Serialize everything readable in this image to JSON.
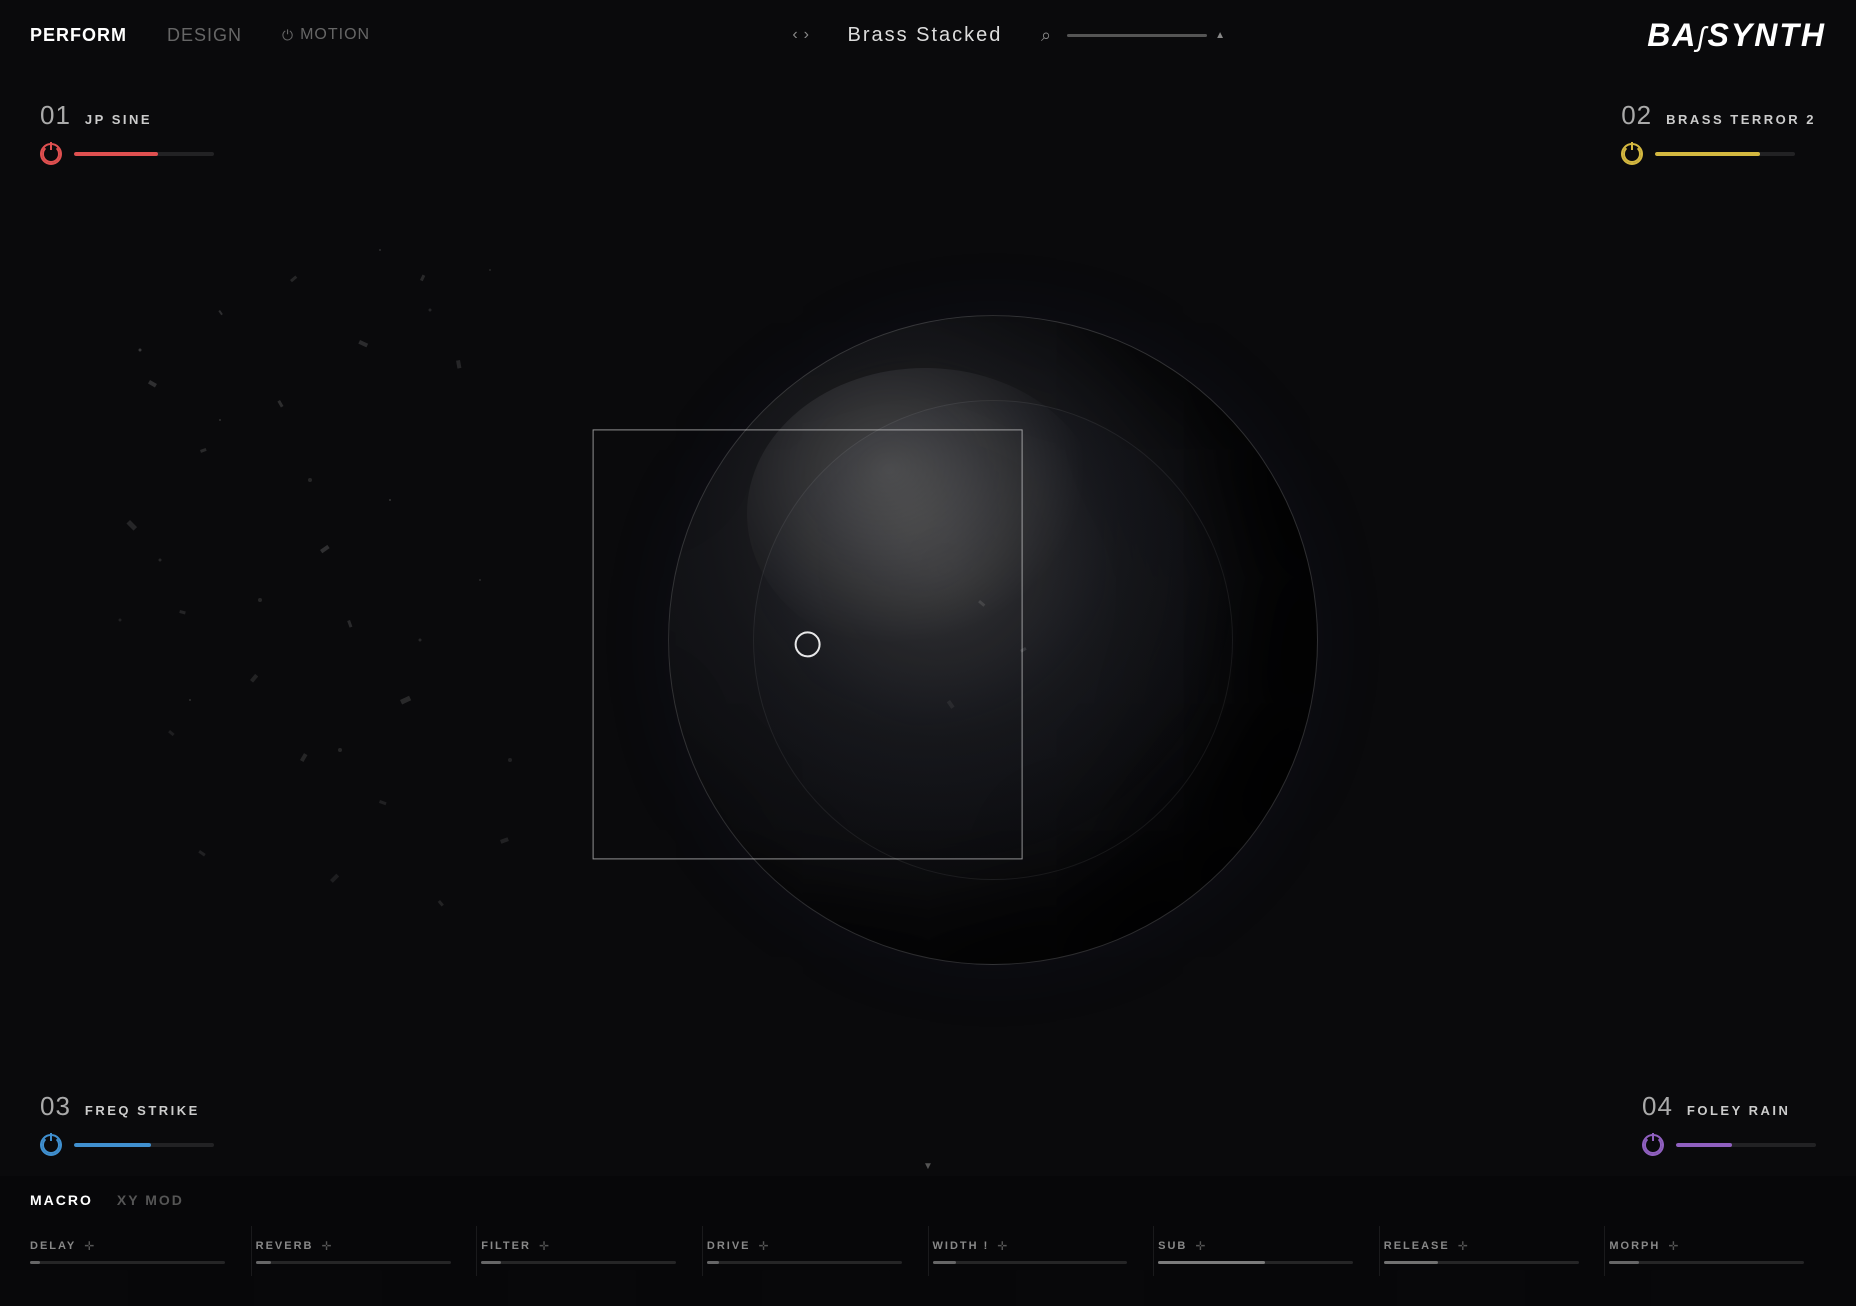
{
  "nav": {
    "items": [
      {
        "id": "perform",
        "label": "PERFORM",
        "active": true
      },
      {
        "id": "design",
        "label": "DESIGN",
        "active": false
      },
      {
        "id": "motion",
        "label": "MOTION",
        "active": false
      }
    ],
    "motion_icon": "⏻",
    "prev_arrow": "‹",
    "next_arrow": "›",
    "preset_name": "Brass Stacked",
    "search_icon": "⌕"
  },
  "logo": {
    "text": "BASSYNTH"
  },
  "layers": {
    "layer1": {
      "number": "01",
      "name": "JP SINE",
      "power_color": "red",
      "bar_color": "red",
      "bar_width": "60%"
    },
    "layer2": {
      "number": "02",
      "name": "BRASS TERROR 2",
      "power_color": "yellow",
      "bar_color": "yellow",
      "bar_width": "75%"
    },
    "layer3": {
      "number": "03",
      "name": "FREQ STRIKE",
      "power_color": "blue",
      "bar_color": "blue",
      "bar_width": "55%"
    },
    "layer4": {
      "number": "04",
      "name": "FOLEY RAIN",
      "power_color": "purple",
      "bar_color": "purple",
      "bar_width": "40%"
    }
  },
  "bottom": {
    "tabs": [
      {
        "label": "MACRO",
        "active": true
      },
      {
        "label": "XY MOD",
        "active": false
      }
    ],
    "macros": [
      {
        "label": "DELAY",
        "fill_width": "5%"
      },
      {
        "label": "REVERB",
        "fill_width": "8%"
      },
      {
        "label": "FILTER",
        "fill_width": "10%"
      },
      {
        "label": "DRIVE",
        "fill_width": "6%"
      },
      {
        "label": "WIDTH !",
        "fill_width": "12%"
      },
      {
        "label": "SUB",
        "fill_width": "55%"
      },
      {
        "label": "RELEASE",
        "fill_width": "28%"
      },
      {
        "label": "MORPH",
        "fill_width": "15%"
      }
    ]
  }
}
